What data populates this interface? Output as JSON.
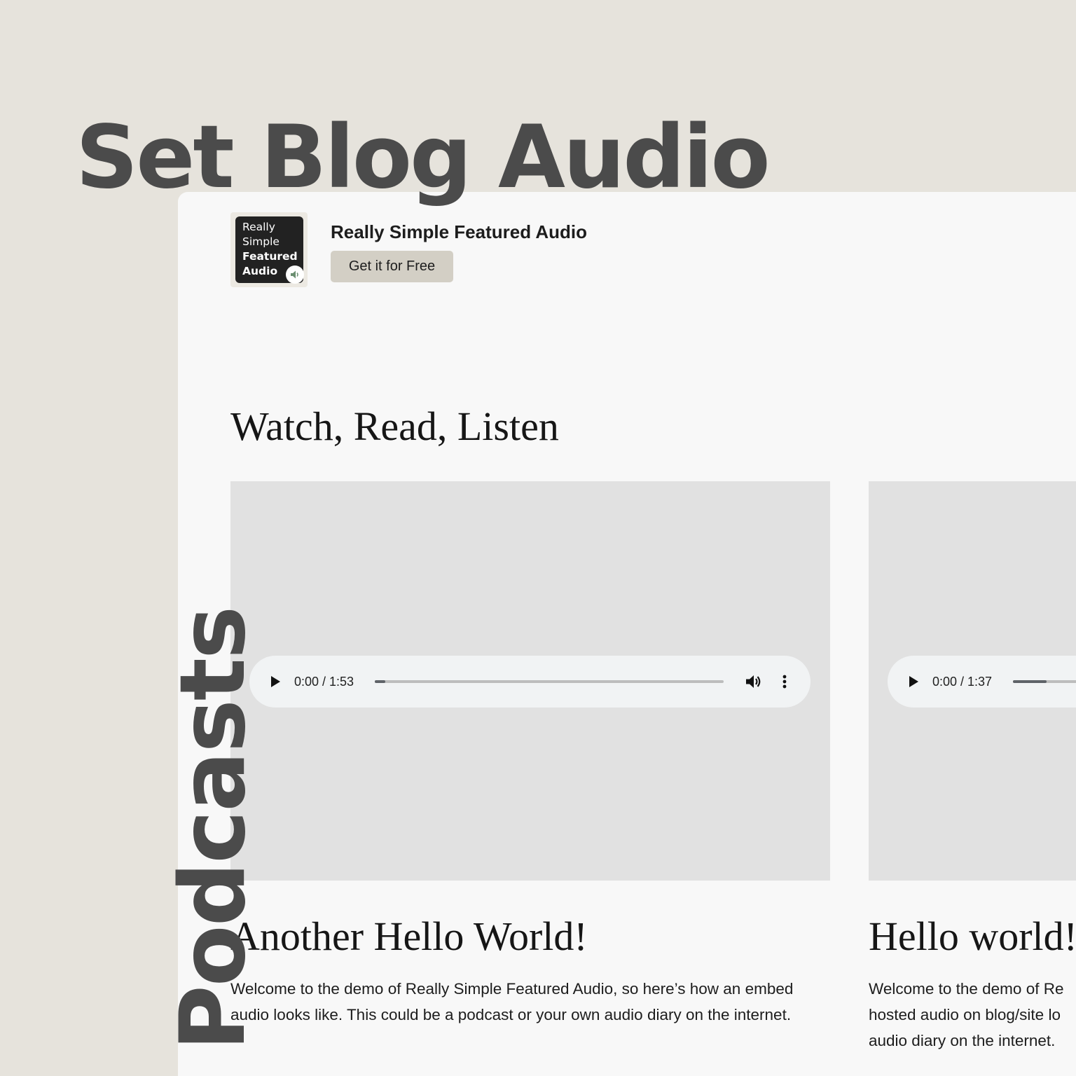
{
  "headline": "Set Blog Audio",
  "vertical_label": "Podcasts",
  "logo": {
    "line1": "Really",
    "line2": "Simple",
    "line3": "Featured",
    "line4": "Audio",
    "badge_icon": "speaker-icon",
    "badge_color": "#6b8f71"
  },
  "brand": {
    "title": "Really Simple Featured Audio",
    "cta_label": "Get it for Free"
  },
  "section": {
    "heading": "Watch, Read, Listen"
  },
  "posts": [
    {
      "player": {
        "time": "0:00 / 1:53",
        "progress": 0.03
      },
      "title": "Another Hello World!",
      "excerpt": "Welcome to the demo of Really Simple Featured Audio, so here’s how an embed audio looks like. This could be a podcast or your own audio diary on the internet."
    },
    {
      "player": {
        "time": "0:00 / 1:37",
        "progress": 0.3
      },
      "title": "Hello world!",
      "excerpt_line1": "Welcome to the demo of Re",
      "excerpt_line2": "hosted audio on blog/site lo",
      "excerpt_line3": "audio diary on the internet."
    }
  ],
  "colors": {
    "background": "#e6e3dc",
    "headline": "#4b4b4b",
    "window": "#f8f8f8",
    "media_placeholder": "#e1e1e1",
    "cta_background": "#d3cfc5",
    "player_background": "#f1f3f4"
  }
}
